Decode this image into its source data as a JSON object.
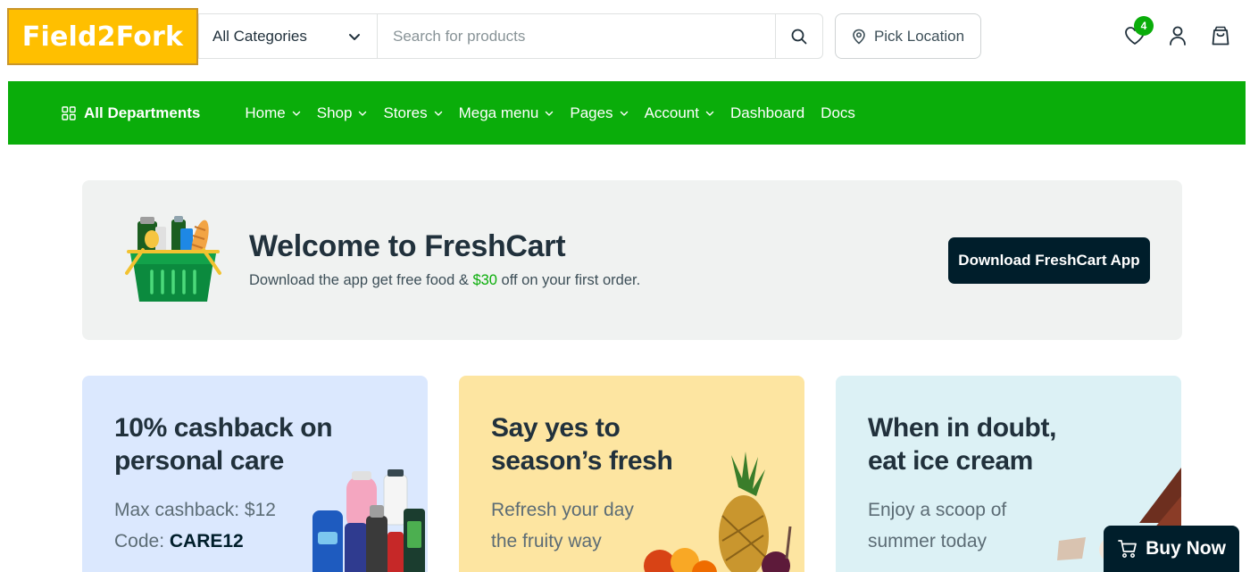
{
  "brand": {
    "logo_text": "Field2Fork",
    "logo_bg": "#ffbf00",
    "accent": "#0aad0a",
    "dark": "#001e2b"
  },
  "header": {
    "category_select": {
      "value": "All Categories"
    },
    "search": {
      "placeholder": "Search for products"
    },
    "location_label": "Pick Location",
    "wishlist_count": "4",
    "icons": [
      "search-icon",
      "location-pin-icon",
      "heart-icon",
      "user-icon",
      "shopping-bag-icon",
      "chevron-down-icon"
    ]
  },
  "navbar": {
    "all_departments": "All Departments",
    "items": [
      {
        "label": "Home",
        "dropdown": true
      },
      {
        "label": "Shop",
        "dropdown": true
      },
      {
        "label": "Stores",
        "dropdown": true
      },
      {
        "label": "Mega menu",
        "dropdown": true
      },
      {
        "label": "Pages",
        "dropdown": true
      },
      {
        "label": "Account",
        "dropdown": true
      },
      {
        "label": "Dashboard",
        "dropdown": false
      },
      {
        "label": "Docs",
        "dropdown": false
      }
    ]
  },
  "welcome": {
    "title": "Welcome to FreshCart",
    "subtitle_pre": "Download the app get free food & ",
    "subtitle_amount": "$30",
    "subtitle_post": " off on your first order.",
    "button_label": "Download FreshCart App"
  },
  "cards": [
    {
      "title": "10% cashback on personal care",
      "line1": "Max cashback: $12",
      "line2_label": "Code: ",
      "line2_value": "CARE12",
      "bg": "#dbe8fe"
    },
    {
      "title": "Say yes to season’s fresh",
      "line1": "Refresh your day",
      "line2_label": "the fruity way",
      "line2_value": "",
      "bg": "#fde5a1"
    },
    {
      "title": "When in doubt, eat ice cream",
      "line1": "Enjoy a scoop of",
      "line2_label": "summer today",
      "line2_value": "",
      "bg": "#dcf1f5"
    }
  ],
  "buy_now": {
    "label": "Buy Now"
  }
}
